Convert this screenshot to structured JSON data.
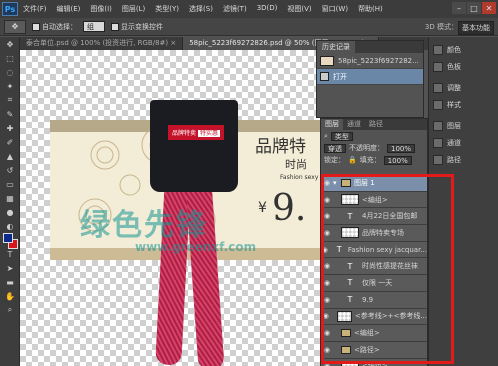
{
  "app": {
    "logo": "Ps"
  },
  "menu": [
    "文件(F)",
    "编辑(E)",
    "图像(I)",
    "图层(L)",
    "类型(Y)",
    "选择(S)",
    "滤镜(T)",
    "3D(D)",
    "视图(V)",
    "窗口(W)",
    "帮助(H)"
  ],
  "window_buttons": [
    "–",
    "□",
    "✕"
  ],
  "options": {
    "auto_select_label": "自动选择：",
    "auto_select_value": "组",
    "transform_label": "显示变换控件",
    "three_d_label": "3D 模式：",
    "workspace": "基本功能"
  },
  "doc_tabs": [
    {
      "label": "泰合单位.psd @ 100% (投资进行, RGB/8#) ×",
      "active": false
    },
    {
      "label": "58pic_5223f69272826.psd @ 50% (图层 1, RGB/8) ×",
      "active": true
    }
  ],
  "canvas": {
    "brand_title": "品牌特",
    "sub_title": "时尚",
    "fashion_text": "Fashion sexy",
    "price_yen": "¥",
    "price_num": "9.",
    "tag_text": "品牌特卖",
    "tag_highlight": "特实惠",
    "watermark": "绿色先锋",
    "watermark_url": "www.greenxf.com"
  },
  "history": {
    "title": "历史记录",
    "rows": [
      {
        "label": "58pic_5223f6927282...",
        "selected": false
      },
      {
        "label": "打开",
        "selected": true
      }
    ]
  },
  "rail": [
    {
      "label": "颜色",
      "icon": "color-icon"
    },
    {
      "label": "色板",
      "icon": "swatches-icon"
    },
    {
      "label": "调整",
      "icon": "adjust-icon"
    },
    {
      "label": "样式",
      "icon": "style-icon"
    },
    {
      "label": "图层",
      "icon": "layers-icon"
    },
    {
      "label": "通道",
      "icon": "channels-icon"
    },
    {
      "label": "路径",
      "icon": "paths-icon"
    }
  ],
  "layers": {
    "tabs": [
      {
        "label": "图层",
        "active": true
      },
      {
        "label": "通道",
        "active": false
      },
      {
        "label": "路径",
        "active": false
      }
    ],
    "kind_filter": "类型",
    "blend_mode": "穿透",
    "opacity_label": "不透明度：",
    "opacity_value": "100%",
    "lock_label": "锁定：",
    "fill_label": "填充：",
    "fill_value": "100%",
    "rows": [
      {
        "type": "group",
        "label": "图层 1",
        "glyph": "▾"
      },
      {
        "type": "image",
        "label": "<编组>"
      },
      {
        "type": "text",
        "label": "4月22日全国包邮"
      },
      {
        "type": "image",
        "label": "品牌特卖专场"
      },
      {
        "type": "text",
        "label": "Fashion sexy jacquar..."
      },
      {
        "type": "text",
        "label": "时尚性感提花丝袜"
      },
      {
        "type": "text",
        "label": "仅限 一天"
      },
      {
        "type": "text",
        "label": "9.9"
      },
      {
        "type": "image",
        "label": "<参考线>+<参考线..."
      },
      {
        "type": "folder",
        "label": "<编组>"
      },
      {
        "type": "folder",
        "label": "<路径>"
      },
      {
        "type": "image",
        "label": "<编组>"
      }
    ]
  }
}
